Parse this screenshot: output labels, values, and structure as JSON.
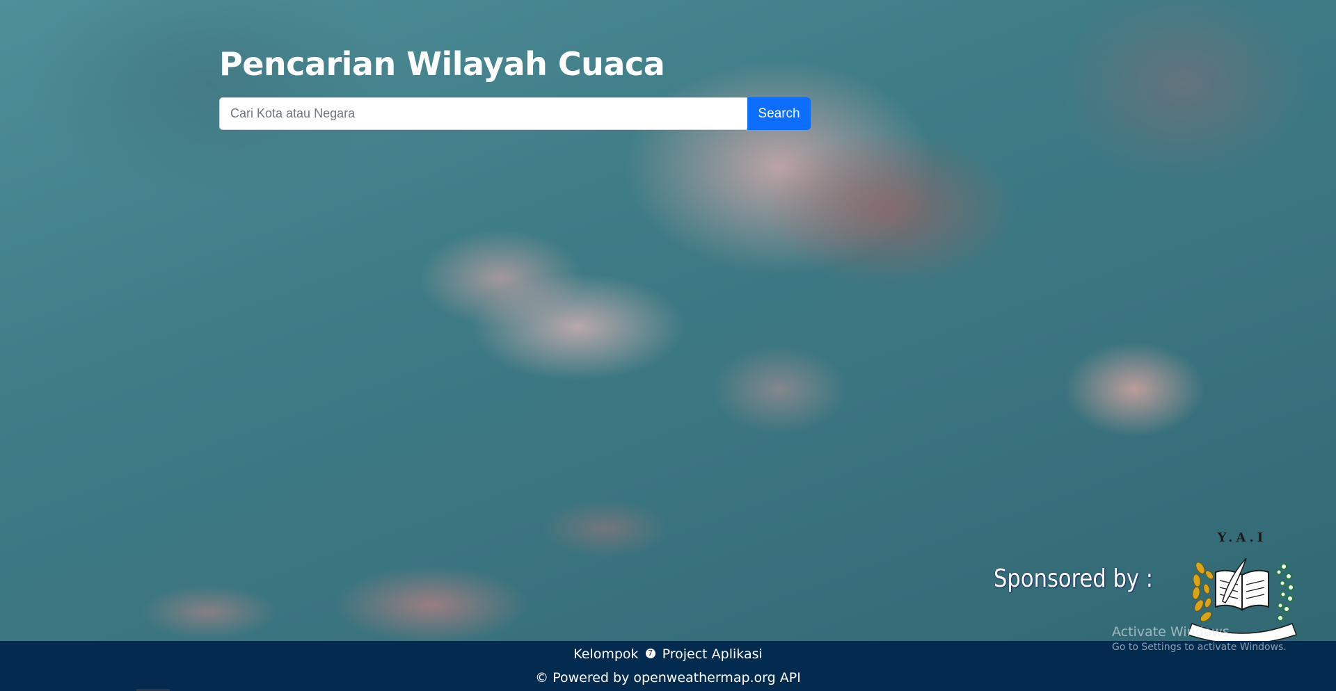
{
  "header": {
    "title": "Pencarian Wilayah Cuaca"
  },
  "search": {
    "placeholder": "Cari Kota atau Negara",
    "value": "",
    "button_label": "Search"
  },
  "sponsor": {
    "label": "Sponsored by :",
    "logo_icon": "yai-jakarta-logo",
    "logo_text": "Y.A.I"
  },
  "footer": {
    "line1_prefix": "Kelompok",
    "group_number": "7",
    "line1_suffix": "Project Aplikasi",
    "line2": "© Powered by openweathermap.org API"
  },
  "watermark": {
    "title": "Activate Windows",
    "subtitle": "Go to Settings to activate Windows."
  },
  "colors": {
    "footer_bg": "#032a4f",
    "button_bg": "#0d6efd",
    "sky": "#3e7c86"
  }
}
